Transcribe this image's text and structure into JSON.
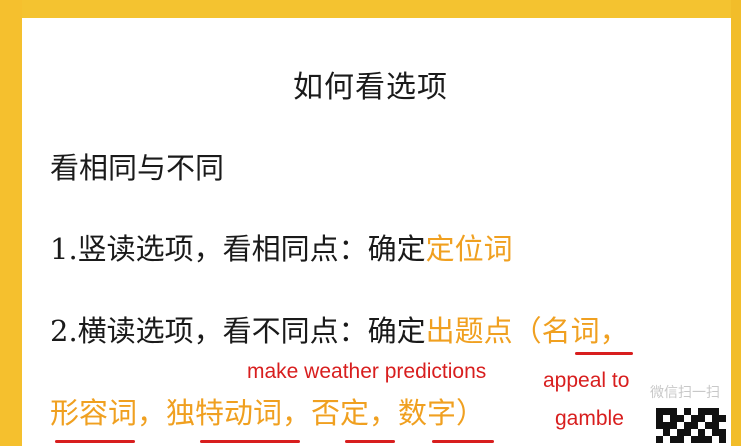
{
  "slide": {
    "title": "如何看选项",
    "line1": "看相同与不同",
    "line2": {
      "prefix": "1.竖读选项，看相同点：确定",
      "highlight": "定位词"
    },
    "line3": {
      "prefix": "2.横读选项，看不同点：确定",
      "highlight": "出题点（名词，"
    },
    "line4": {
      "highlight": "形容词，独特动词，否定，数字）"
    }
  },
  "annotations": {
    "weather": "make weather predictions",
    "appeal_line1": "appeal to",
    "appeal_line2": "gamble"
  },
  "watermark": {
    "text": "微信扫一扫"
  },
  "colors": {
    "frame": "#f4c330",
    "highlight": "#f0a020",
    "annotation": "#d81e1e",
    "text": "#1a1a1a"
  }
}
